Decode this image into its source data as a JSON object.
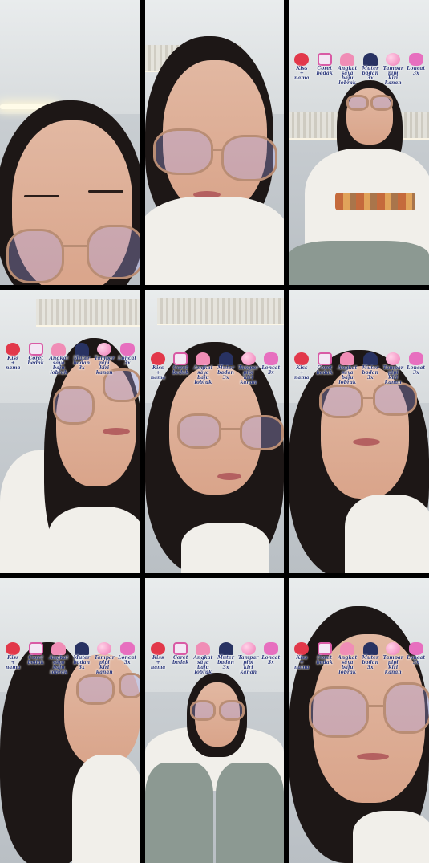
{
  "grid": {
    "columns": 3,
    "rows": 3
  },
  "effect_labels": {
    "kiss": "Kiss\n+\nnama",
    "coret": "Coret\nbedak",
    "angkat": "Angkat\nsaya\nbaju\nlobrak",
    "muter": "Muter\nbadan 3x",
    "tampar": "Tampar\npipi kiri\nkanan",
    "loncat": "Loncat\n3x"
  },
  "effect_icons": [
    "lips-icon",
    "frame-icon",
    "cone-icon",
    "cap-icon",
    "ball-icon",
    "heart-icon"
  ],
  "colors": {
    "label_text": "#2e3a7d",
    "divider": "#000000",
    "shirt": "#f1efea",
    "hair": "#1d1716"
  }
}
